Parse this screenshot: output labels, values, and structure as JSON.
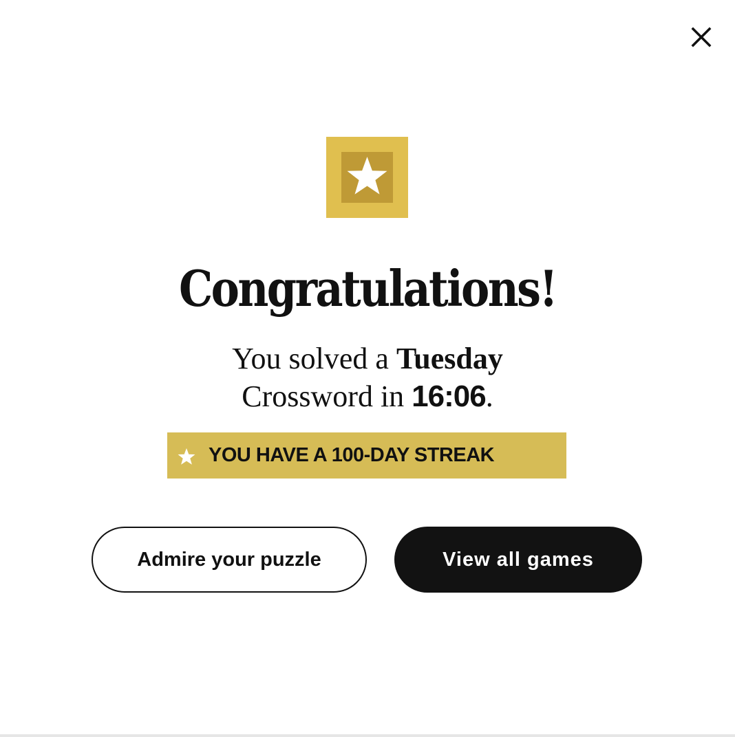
{
  "modal": {
    "close_icon": "close-icon",
    "badge_icon": "star-icon",
    "title": "Congratulations!",
    "message": {
      "prefix": "You solved a ",
      "day": "Tuesday",
      "middle": "Crossword in ",
      "time": "16:06",
      "suffix": "."
    },
    "streak": {
      "icon": "star-icon",
      "text": "YOU HAVE A 100-DAY STREAK"
    },
    "buttons": {
      "admire_label": "Admire your puzzle",
      "games_label": "View all games"
    }
  },
  "colors": {
    "badge_outer": "#e0bf4f",
    "badge_inner": "#bf9a36",
    "streak_banner": "#d6bc56",
    "primary_button": "#121212",
    "text": "#111111"
  }
}
